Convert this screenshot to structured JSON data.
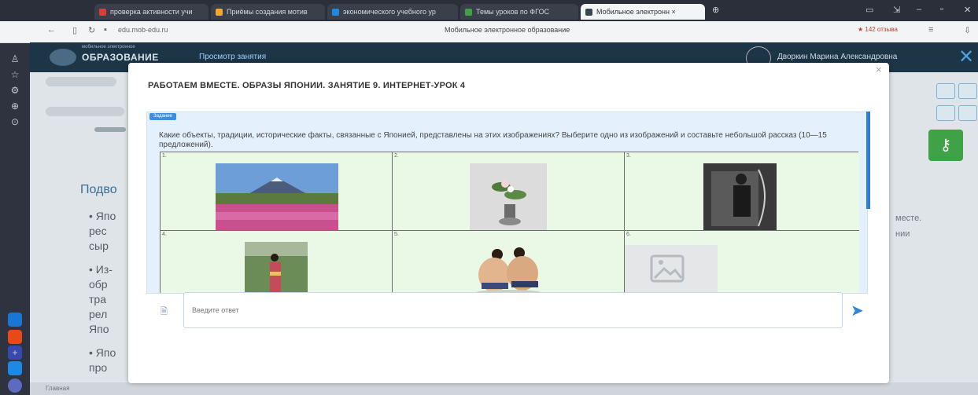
{
  "browser": {
    "tabs": [
      {
        "label": "проверка активности учи",
        "color": "#e53935"
      },
      {
        "label": "Приёмы создания мотив",
        "color": "#f9a825"
      },
      {
        "label": "экономического учебного ур",
        "color": "#1e88e5"
      },
      {
        "label": "Темы уроков по ФГОС",
        "color": "#43a047"
      },
      {
        "label": "Мобильное электронн ×",
        "color": "#37474f"
      }
    ],
    "url": "edu.mob-edu.ru",
    "page_title": "Мобильное электронное образование",
    "rating": "★ 142 отзыва"
  },
  "site": {
    "logo_sub": "мобильное электронное",
    "logo_text": "ОБРАЗОВАНИЕ",
    "header_link": "Просмотр занятия",
    "user_name": "Дворкин Марина Александровна"
  },
  "background": {
    "heading": "Подво",
    "bullets": [
      "• Япо",
      "  рес",
      "  сыр",
      "• Из-",
      "  обр",
      "  тра",
      "  рел",
      "  Япо",
      "• Япо",
      "  про"
    ],
    "right_text": [
      "месте.",
      "нии"
    ],
    "status": "Главная"
  },
  "modal": {
    "title": "РАБОТАЕМ ВМЕСТЕ. ОБРАЗЫ ЯПОНИИ. ЗАНЯТИЕ 9. ИНТЕРНЕТ-УРОК 4",
    "close": "×",
    "task_badge": "Задание",
    "task_text": "Какие объекты, традиции, исторические факты, связанные с Японией, представлены на этих изображениях? Выберите одно из изображений и составьте небольшой рассказ (10—15 предложений).",
    "cells": [
      "1.",
      "2.",
      "3.",
      "4.",
      "5.",
      "6."
    ],
    "images": [
      "fuji-landscape-photo",
      "ikebana-photo",
      "samurai-archer-photo",
      "woman-in-kimono-photo",
      "sumo-wrestlers-photo",
      "image-placeholder-icon"
    ],
    "answer_placeholder": "Введите ответ"
  }
}
